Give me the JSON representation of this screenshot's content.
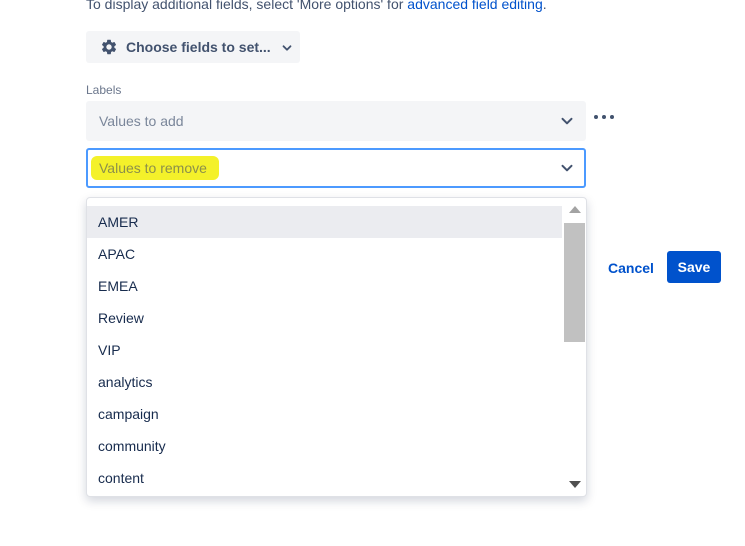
{
  "info": {
    "text": "To display additional fields, select 'More options' for",
    "link": "advanced field editing",
    "suffix": "."
  },
  "choose_fields": {
    "label": "Choose fields to set...",
    "icon": "gear-icon"
  },
  "labels_field": {
    "label": "Labels",
    "add_placeholder": "Values to add",
    "remove_placeholder": "Values to remove"
  },
  "dropdown": {
    "options": [
      "AMER",
      "APAC",
      "EMEA",
      "Review",
      "VIP",
      "analytics",
      "campaign",
      "community",
      "content"
    ],
    "highlighted": "AMER"
  },
  "actions": {
    "cancel": "Cancel",
    "save": "Save"
  },
  "colors": {
    "accent": "#0052cc",
    "focus_border": "#4c9aff",
    "highlight": "#f4f12a",
    "field_bg": "#f4f5f7"
  }
}
